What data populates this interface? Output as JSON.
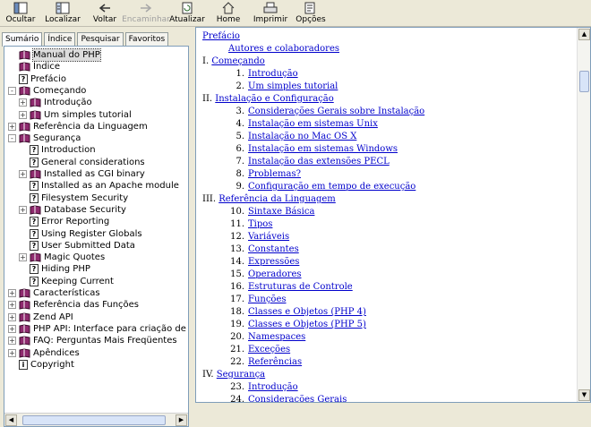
{
  "toolbar": {
    "hide": "Ocultar",
    "locate": "Localizar",
    "back": "Voltar",
    "forward": "Encaminhar",
    "refresh": "Atualizar",
    "home": "Home",
    "print": "Imprimir",
    "options": "Opções"
  },
  "tabs": [
    "Sumário",
    "Índice",
    "Pesquisar",
    "Favoritos"
  ],
  "tree": [
    {
      "label": "Manual do PHP",
      "icon": "book-icon",
      "level": 0,
      "exp": ""
    },
    {
      "label": "Índice",
      "icon": "book-icon",
      "level": 0,
      "exp": ""
    },
    {
      "label": "Prefácio",
      "icon": "page-icon",
      "level": 0,
      "exp": ""
    },
    {
      "label": "Começando",
      "icon": "book-icon",
      "level": 0,
      "exp": "-"
    },
    {
      "label": "Introdução",
      "icon": "book-icon",
      "level": 1,
      "exp": "+"
    },
    {
      "label": "Um simples tutorial",
      "icon": "book-icon",
      "level": 1,
      "exp": "+"
    },
    {
      "label": "Referência da Linguagem",
      "icon": "book-icon",
      "level": 0,
      "exp": "+"
    },
    {
      "label": "Segurança",
      "icon": "book-icon",
      "level": 0,
      "exp": "-"
    },
    {
      "label": "Introduction",
      "icon": "page-icon",
      "level": 1,
      "exp": ""
    },
    {
      "label": "General considerations",
      "icon": "page-icon",
      "level": 1,
      "exp": ""
    },
    {
      "label": "Installed as CGI binary",
      "icon": "book-icon",
      "level": 1,
      "exp": "+"
    },
    {
      "label": "Installed as an Apache module",
      "icon": "page-icon",
      "level": 1,
      "exp": ""
    },
    {
      "label": "Filesystem Security",
      "icon": "page-icon",
      "level": 1,
      "exp": ""
    },
    {
      "label": "Database Security",
      "icon": "book-icon",
      "level": 1,
      "exp": "+"
    },
    {
      "label": "Error Reporting",
      "icon": "page-icon",
      "level": 1,
      "exp": ""
    },
    {
      "label": "Using Register Globals",
      "icon": "page-icon",
      "level": 1,
      "exp": ""
    },
    {
      "label": "User Submitted Data",
      "icon": "page-icon",
      "level": 1,
      "exp": ""
    },
    {
      "label": "Magic Quotes",
      "icon": "book-icon",
      "level": 1,
      "exp": "+"
    },
    {
      "label": "Hiding PHP",
      "icon": "page-icon",
      "level": 1,
      "exp": ""
    },
    {
      "label": "Keeping Current",
      "icon": "page-icon",
      "level": 1,
      "exp": ""
    },
    {
      "label": "Características",
      "icon": "book-icon",
      "level": 0,
      "exp": "+"
    },
    {
      "label": "Referência das Funções",
      "icon": "book-icon",
      "level": 0,
      "exp": "+"
    },
    {
      "label": "Zend API",
      "icon": "book-icon",
      "level": 0,
      "exp": "+"
    },
    {
      "label": "PHP API: Interface para criação de ext",
      "icon": "book-icon",
      "level": 0,
      "exp": "+"
    },
    {
      "label": "FAQ: Perguntas Mais Freqüentes",
      "icon": "book-icon",
      "level": 0,
      "exp": "+"
    },
    {
      "label": "Apêndices",
      "icon": "book-icon",
      "level": 0,
      "exp": "+"
    },
    {
      "label": "Copyright",
      "icon": "info-icon",
      "level": 0,
      "exp": ""
    }
  ],
  "content": [
    {
      "num": "",
      "text": "Prefácio",
      "indent": 0
    },
    {
      "num": "",
      "text": "Autores e colaboradores",
      "indent": 2
    },
    {
      "num": "I.",
      "text": "Começando",
      "indent": 0
    },
    {
      "num": "1.",
      "text": "Introdução",
      "indent": 1
    },
    {
      "num": "2.",
      "text": "Um simples tutorial",
      "indent": 1
    },
    {
      "num": "II.",
      "text": "Instalação e Configuração",
      "indent": 0
    },
    {
      "num": "3.",
      "text": "Considerações Gerais sobre Instalação",
      "indent": 1
    },
    {
      "num": "4.",
      "text": "Instalação em sistemas Unix",
      "indent": 1
    },
    {
      "num": "5.",
      "text": "Instalação no Mac OS X",
      "indent": 1
    },
    {
      "num": "6.",
      "text": "Instalação em sistemas Windows",
      "indent": 1
    },
    {
      "num": "7.",
      "text": "Instalação das extensões PECL",
      "indent": 1
    },
    {
      "num": "8.",
      "text": "Problemas?",
      "indent": 1
    },
    {
      "num": "9.",
      "text": "Configuração em tempo de execução",
      "indent": 1
    },
    {
      "num": "III.",
      "text": "Referência da Linguagem",
      "indent": 0
    },
    {
      "num": "10.",
      "text": "Sintaxe Básica",
      "indent": 1
    },
    {
      "num": "11.",
      "text": "Tipos",
      "indent": 1
    },
    {
      "num": "12.",
      "text": "Variáveis",
      "indent": 1
    },
    {
      "num": "13.",
      "text": "Constantes",
      "indent": 1
    },
    {
      "num": "14.",
      "text": "Expressões",
      "indent": 1
    },
    {
      "num": "15.",
      "text": "Operadores",
      "indent": 1
    },
    {
      "num": "16.",
      "text": "Estruturas de Controle",
      "indent": 1
    },
    {
      "num": "17.",
      "text": "Funções",
      "indent": 1
    },
    {
      "num": "18.",
      "text": "Classes e Objetos (PHP 4)",
      "indent": 1
    },
    {
      "num": "19.",
      "text": "Classes e Objetos (PHP 5)",
      "indent": 1
    },
    {
      "num": "20.",
      "text": "Namespaces",
      "indent": 1
    },
    {
      "num": "21.",
      "text": "Exceções",
      "indent": 1
    },
    {
      "num": "22.",
      "text": "Referências",
      "indent": 1
    },
    {
      "num": "IV.",
      "text": "Segurança",
      "indent": 0
    },
    {
      "num": "23.",
      "text": "Introdução",
      "indent": 1
    },
    {
      "num": "24.",
      "text": "Considerações Gerais",
      "indent": 1
    }
  ]
}
